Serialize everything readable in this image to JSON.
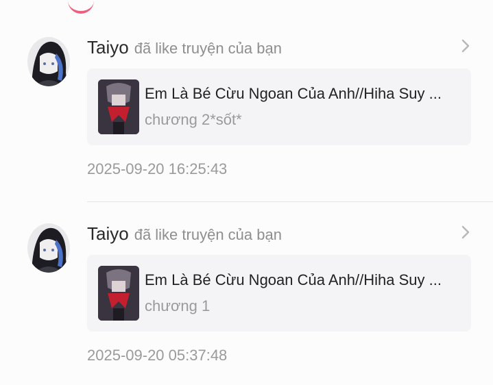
{
  "notifications": [
    {
      "user": "Taiyo",
      "action": "đã like truyện của bạn",
      "story_title": "Em Là Bé Cừu Ngoan Của Anh//Hiha Suy ...",
      "chapter": "chương 2*sốt*",
      "timestamp": "2025-09-20 16:25:43"
    },
    {
      "user": "Taiyo",
      "action": "đã like truyện của bạn",
      "story_title": "Em Là Bé Cừu Ngoan Của Anh//Hiha Suy ...",
      "chapter": "chương 1",
      "timestamp": "2025-09-20 05:37:48"
    }
  ],
  "icons": {
    "chevron": "chevron-right-icon",
    "avatar": "user-avatar",
    "cover": "story-cover-thumbnail"
  },
  "colors": {
    "accent": "#ee5f7e",
    "card_bg": "#f4f4f6",
    "muted_text": "#9a9a9a"
  }
}
